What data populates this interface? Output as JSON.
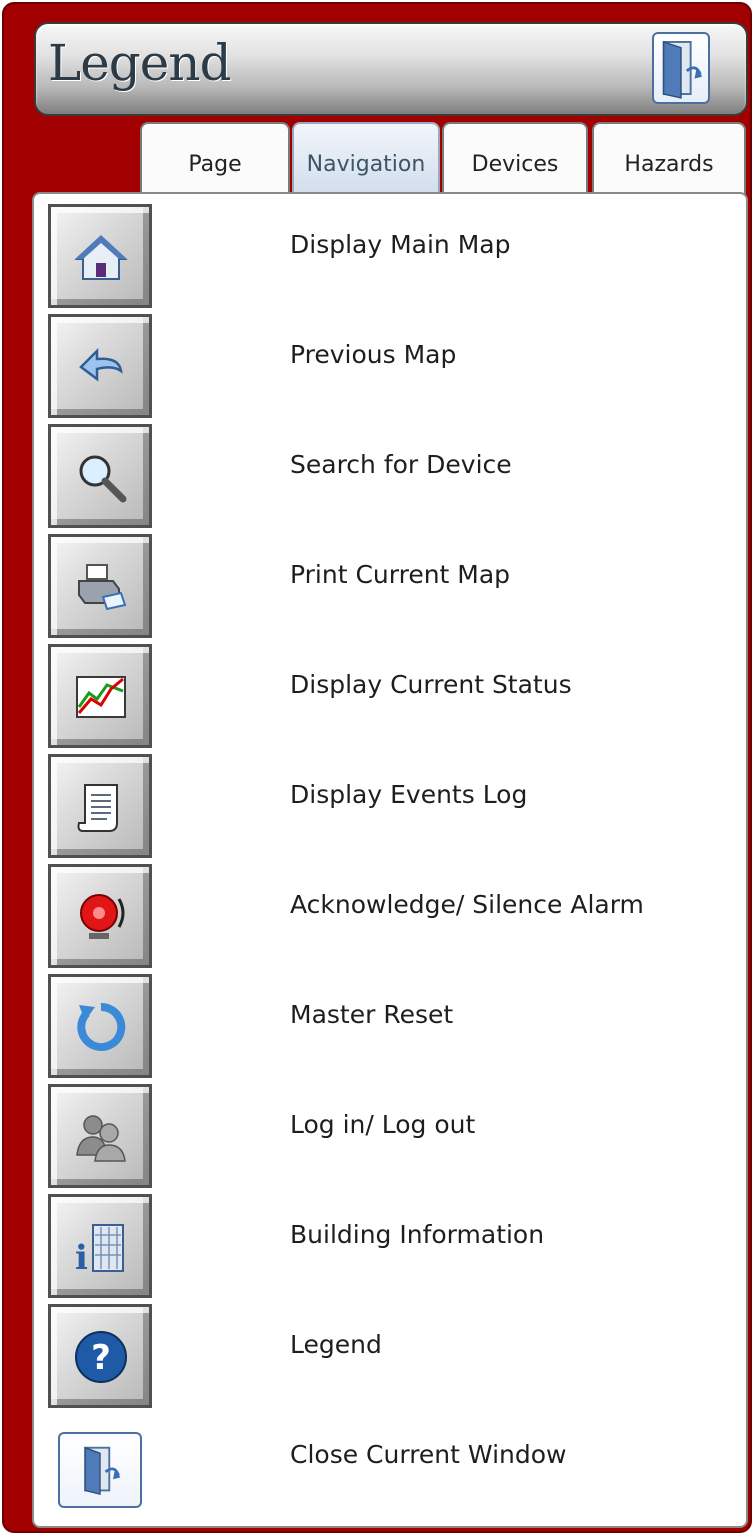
{
  "window": {
    "title": "Legend",
    "close_icon": "door-exit-icon"
  },
  "tabs": [
    {
      "label": "Page",
      "active": false
    },
    {
      "label": "Navigation",
      "active": true
    },
    {
      "label": "Devices",
      "active": false
    },
    {
      "label": "Hazards",
      "active": false
    }
  ],
  "legend_items": [
    {
      "icon": "home-icon",
      "label": "Display Main Map"
    },
    {
      "icon": "back-arrow-icon",
      "label": "Previous Map"
    },
    {
      "icon": "magnifier-icon",
      "label": "Search for Device"
    },
    {
      "icon": "printer-icon",
      "label": "Print Current Map"
    },
    {
      "icon": "status-chart-icon",
      "label": "Display Current Status"
    },
    {
      "icon": "log-scroll-icon",
      "label": "Display Events Log"
    },
    {
      "icon": "alarm-bell-icon",
      "label": "Acknowledge/ Silence Alarm"
    },
    {
      "icon": "reset-icon",
      "label": "Master Reset"
    },
    {
      "icon": "users-icon",
      "label": "Log in/ Log out"
    },
    {
      "icon": "building-info-icon",
      "label": "Building Information"
    },
    {
      "icon": "help-icon",
      "label": "Legend"
    },
    {
      "icon": "door-exit-icon",
      "label": "Close Current Window"
    }
  ],
  "colors": {
    "frame": "#a20000",
    "active_tab": "#cfdceb",
    "accent_blue": "#3a6fb6"
  }
}
